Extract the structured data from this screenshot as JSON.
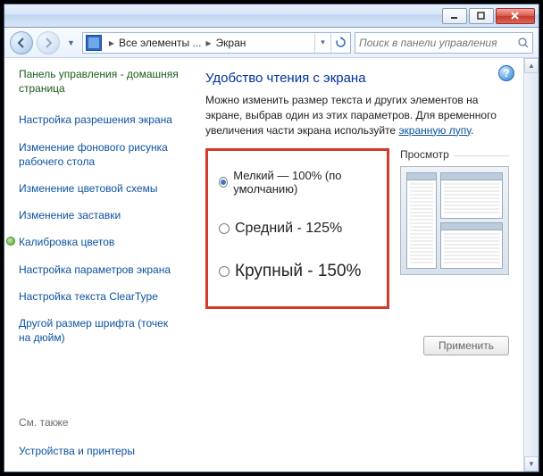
{
  "breadcrumb": {
    "seg1": "Все элементы ...",
    "seg2": "Экран"
  },
  "search": {
    "placeholder": "Поиск в панели управления"
  },
  "sidebar": {
    "title": "Панель управления - домашняя страница",
    "links": [
      "Настройка разрешения экрана",
      "Изменение фонового рисунка рабочего стола",
      "Изменение цветовой схемы",
      "Изменение заставки",
      "Калибровка цветов",
      "Настройка параметров экрана",
      "Настройка текста ClearType",
      "Другой размер шрифта (точек на дюйм)"
    ],
    "see_also": "См. также",
    "devices": "Устройства и принтеры"
  },
  "main": {
    "title": "Удобство чтения с экрана",
    "desc_part1": "Можно изменить размер текста и других элементов на экране, выбрав один из этих параметров. Для временного увеличения части экрана используйте ",
    "desc_link": "экранную лупу",
    "desc_part2": ".",
    "options": {
      "small": "Мелкий — 100% (по умолчанию)",
      "medium": "Средний - 125%",
      "large": "Крупный - 150%"
    },
    "preview_label": "Просмотр",
    "apply": "Применить"
  }
}
